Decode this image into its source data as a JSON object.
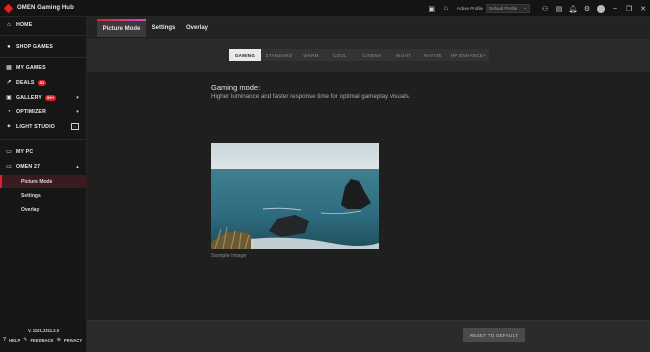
{
  "app": {
    "title": "OMEN Gaming Hub",
    "brand_color": "#e0202a"
  },
  "titlebar": {
    "icons": [
      "notifications-panel-icon",
      "home-icon"
    ],
    "active_profile_label": "Active Profile",
    "active_profile_value": "Default Profile",
    "right_icons": [
      "controller-icon",
      "gallery-icon",
      "bell-icon",
      "gear-icon",
      "avatar"
    ],
    "window_controls": [
      "minimize",
      "restore",
      "close"
    ]
  },
  "sidebar": {
    "items": [
      {
        "label": "HOME",
        "icon": "home-icon"
      },
      {
        "label": "SHOP GAMES",
        "icon": "shop-icon"
      },
      {
        "label": "MY GAMES",
        "icon": "games-icon"
      },
      {
        "label": "DEALS",
        "icon": "deals-icon",
        "badge": "51"
      },
      {
        "label": "GALLERY",
        "icon": "gallery-icon",
        "badge": "99+"
      },
      {
        "label": "OPTIMIZER",
        "icon": "optimizer-icon"
      },
      {
        "label": "LIGHT STUDIO",
        "icon": "light-studio-icon"
      },
      {
        "label": "MY PC",
        "icon": "pc-icon"
      },
      {
        "label": "OMEN 27",
        "icon": "monitor-icon"
      }
    ],
    "sub_items": [
      "Picture Mode",
      "Settings",
      "Overlay"
    ],
    "version": "V. 1101.2311.2.0",
    "footer": {
      "help": "HELP",
      "feedback": "FEEDBACK",
      "privacy": "PRIVACY"
    }
  },
  "tabs": [
    {
      "label": "Picture Mode",
      "active": true
    },
    {
      "label": "Settings",
      "active": false
    },
    {
      "label": "Overlay",
      "active": false
    }
  ],
  "picture_modes": [
    "GAMING",
    "STANDARD",
    "WARM",
    "COOL",
    "CINEMA",
    "NIGHT",
    "NATIVE",
    "HP ENHANCE+"
  ],
  "selected_mode": "GAMING",
  "mode_info": {
    "title": "Gaming mode:",
    "description": "Higher luminance and faster response time for optimal gameplay visuals."
  },
  "sample_caption": "Sample Image",
  "reset_button": "RESET TO DEFAULT"
}
